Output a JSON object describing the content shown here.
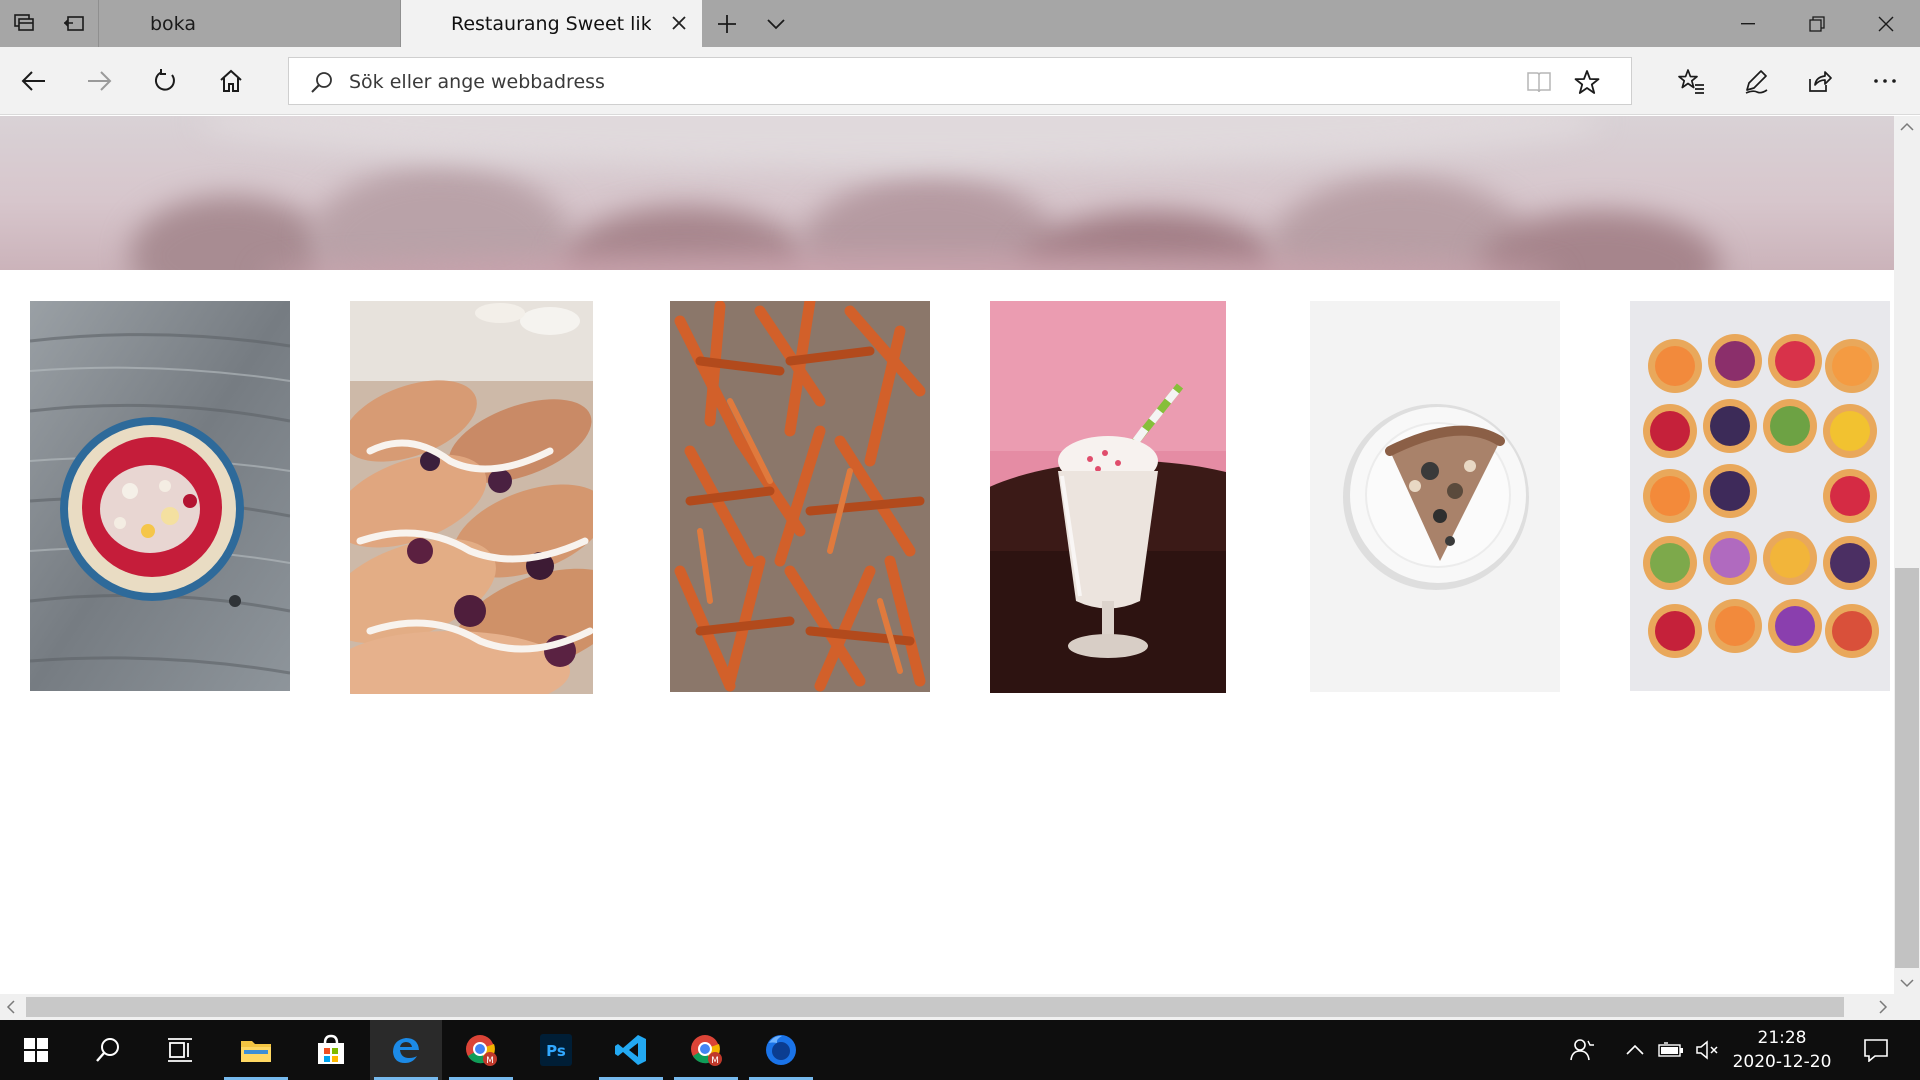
{
  "browser": {
    "tabs": [
      {
        "title": "boka",
        "active": false
      },
      {
        "title": "Restaurang Sweet like C",
        "active": true
      }
    ],
    "address_placeholder": "Sök eller ange webbadress",
    "icons": {
      "tab_preview": "tab-preview-icon",
      "set_aside": "set-aside-tabs-icon",
      "new_tab": "plus-icon",
      "tab_list": "chevron-down-icon",
      "minimize": "minimize-icon",
      "restore": "restore-icon",
      "close": "close-icon",
      "back": "back-arrow-icon",
      "forward": "forward-arrow-icon",
      "refresh": "refresh-icon",
      "home": "home-icon",
      "search": "search-icon",
      "reading_view": "reading-view-icon",
      "favorite": "star-icon",
      "favorites_hub": "favorites-hub-icon",
      "web_note": "pen-icon",
      "share": "share-icon",
      "more": "more-icon"
    }
  },
  "page": {
    "gallery": [
      {
        "name": "acai-bowl-image"
      },
      {
        "name": "pastry-image"
      },
      {
        "name": "sweet-potato-fries-image"
      },
      {
        "name": "milkshake-image"
      },
      {
        "name": "pizza-slice-image"
      },
      {
        "name": "fruit-tarts-image"
      }
    ]
  },
  "taskbar": {
    "apps": [
      "start",
      "search",
      "task-view",
      "file-explorer",
      "microsoft-store",
      "edge",
      "chrome",
      "photoshop",
      "vscode",
      "chrome-2",
      "firefox"
    ],
    "time": "21:28",
    "date": "2020-12-20"
  },
  "colors": {
    "tabbar_bg": "#a6a6a6",
    "toolbar_bg": "#f2f2f2",
    "taskbar_bg": "#0e0e0e",
    "accent": "#0078d7"
  }
}
